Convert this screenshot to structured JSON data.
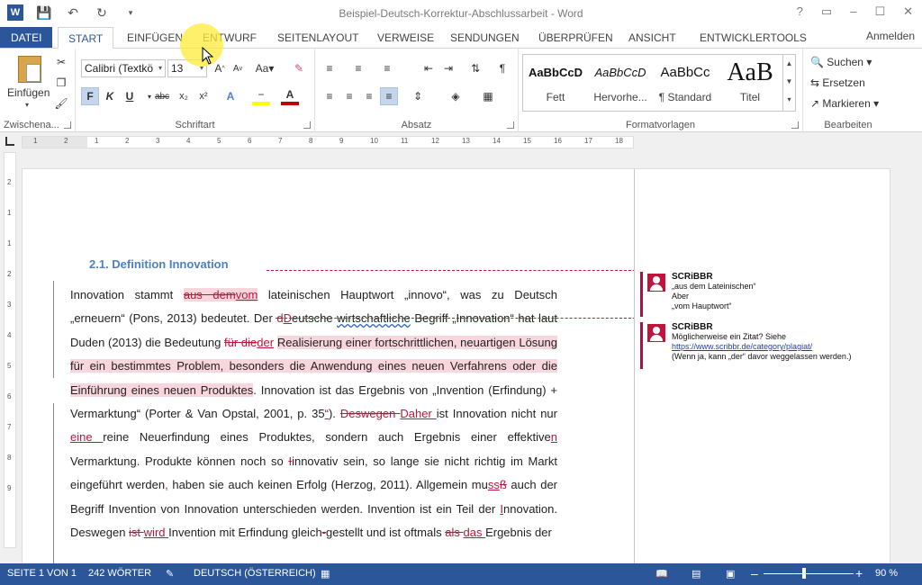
{
  "window": {
    "title": "Beispiel-Deutsch-Korrektur-Abschlussarbeit - Word",
    "help": "?",
    "controls": [
      "▭",
      "–",
      "☐",
      "✕"
    ]
  },
  "tabs": [
    {
      "label": "DATEI"
    },
    {
      "label": "START"
    },
    {
      "label": "EINFÜGEN"
    },
    {
      "label": "ENTWURF"
    },
    {
      "label": "SEITENLAYOUT"
    },
    {
      "label": "VERWEISE"
    },
    {
      "label": "SENDUNGEN"
    },
    {
      "label": "ÜBERPRÜFEN"
    },
    {
      "label": "ANSICHT"
    },
    {
      "label": "ENTWICKLERTOOLS"
    }
  ],
  "signin": "Anmelden",
  "ribbon": {
    "clipboard": {
      "paste_label": "Einfügen",
      "group": "Zwischena..."
    },
    "font": {
      "font_name": "Calibri (Textkö",
      "font_size": "13",
      "group": "Schriftart",
      "buttons": [
        "F",
        "K",
        "U",
        "abc",
        "x₂",
        "x²"
      ]
    },
    "paragraph": {
      "group": "Absatz"
    },
    "styles": {
      "group": "Formatvorlagen",
      "items": [
        {
          "preview": "AaBbCcD",
          "name": "Fett"
        },
        {
          "preview": "AaBbCcD",
          "name": "Hervorhe..."
        },
        {
          "preview": "AaBbCc",
          "name": "¶ Standard"
        },
        {
          "preview": "AaB",
          "name": "Titel"
        }
      ]
    },
    "editing": {
      "group": "Bearbeiten",
      "search": "Suchen",
      "replace": "Ersetzen",
      "select": "Markieren"
    }
  },
  "ruler": {
    "h_numbers": [
      "1",
      "2",
      "1",
      "2",
      "3",
      "4",
      "5",
      "6",
      "7",
      "8",
      "9",
      "10",
      "11",
      "12",
      "13",
      "14",
      "15",
      "16",
      "17",
      "18"
    ],
    "v_numbers": [
      "2",
      "1",
      "1",
      "2",
      "3",
      "4",
      "5",
      "6",
      "7",
      "8",
      "9"
    ]
  },
  "document": {
    "heading": "2.1. Definition Innovation",
    "lines": [
      [
        {
          "t": "Innovation stammt "
        },
        {
          "t": "aus dem",
          "c": "del hl"
        },
        {
          "t": "vom",
          "c": "ins hl"
        },
        {
          "t": " lateinischen Hauptwort „innovo“, was zu Deutsch"
        }
      ],
      [
        {
          "t": "„erneuern“ (Pons, 2013) bedeutet. Der "
        },
        {
          "t": "d",
          "c": "del"
        },
        {
          "t": "D",
          "c": "ins"
        },
        {
          "t": "eutsche "
        },
        {
          "t": "wirtschaftliche",
          "c": "squig"
        },
        {
          "t": " Begriff „Innovation“ hat laut"
        }
      ],
      [
        {
          "t": "Duden (2013) die Bedeutung "
        },
        {
          "t": "für die",
          "c": "del"
        },
        {
          "t": "der",
          "c": "ins"
        },
        {
          "t": " "
        },
        {
          "t": "Realisierung einer fortschrittlichen, neuartigen Lösung",
          "c": "hl"
        }
      ],
      [
        {
          "t": "für ein bestimmtes Problem, besonders die Anwendung eines neuen Verfahrens oder die",
          "c": "hl"
        }
      ],
      [
        {
          "t": "Einführung eines neuen Produktes",
          "c": "hl"
        },
        {
          "t": ". Innovation ist das Ergebnis von „Invention (Erfindung) +"
        }
      ],
      [
        {
          "t": "Vermarktung“ (Porter & Van Opstal, 2001, p. 35"
        },
        {
          "t": "“",
          "c": "ins"
        },
        {
          "t": "). "
        },
        {
          "t": "Deswegen ",
          "c": "del"
        },
        {
          "t": "Daher ",
          "c": "ins"
        },
        {
          "t": "ist Innovation nicht nur"
        }
      ],
      [
        {
          "t": "eine ",
          "c": "ins"
        },
        {
          "t": " reine Neuerfindung eines Produktes, sondern auch Ergebnis einer effektive"
        },
        {
          "t": "n",
          "c": "ins"
        }
      ],
      [
        {
          "t": "Vermarktung. Produkte können noch so "
        },
        {
          "t": "I",
          "c": "del"
        },
        {
          "t": "innovativ sein, so lange sie nicht richtig im Markt"
        }
      ],
      [
        {
          "t": "eingeführt werden"
        },
        {
          "t": ",",
          "c": "ins"
        },
        {
          "t": " haben sie auch keinen Erfolg (Herzog, 2011). Allgemein mu"
        },
        {
          "t": "ss",
          "c": "ins"
        },
        {
          "t": "ß",
          "c": "del"
        },
        {
          "t": " auch der"
        }
      ],
      [
        {
          "t": "Begriff Invention von Innovation unterschieden werden. Invention ist ein Teil der "
        },
        {
          "t": "I",
          "c": "ins"
        },
        {
          "t": "nnovation."
        }
      ],
      [
        {
          "t": "Deswegen "
        },
        {
          "t": "ist ",
          "c": "del"
        },
        {
          "t": "wird ",
          "c": "ins"
        },
        {
          "t": "Invention mit Erfindung gleich"
        },
        {
          "t": "-",
          "c": "del"
        },
        {
          "t": "gestellt und ist oftmals "
        },
        {
          "t": "als ",
          "c": "del"
        },
        {
          "t": "das ",
          "c": "ins"
        },
        {
          "t": "Ergebnis der"
        }
      ]
    ]
  },
  "comments": [
    {
      "author": "SCRiBBR",
      "lines": [
        "„aus dem Lateinischen“",
        "Aber",
        "„vom Hauptwort“"
      ]
    },
    {
      "author": "SCRiBBR",
      "line1": "Möglicherweise ein Zitat? Siehe",
      "link": "https://www.scribbr.de/category/plagiat/",
      "line3": "(Wenn ja, kann „der“ davor weggelassen werden.)"
    }
  ],
  "status": {
    "page": "SEITE 1 VON 1",
    "words": "242 WÖRTER",
    "language": "DEUTSCH (ÖSTERREICH)",
    "zoom": "90 %",
    "zoom_fraction": 0.45
  }
}
